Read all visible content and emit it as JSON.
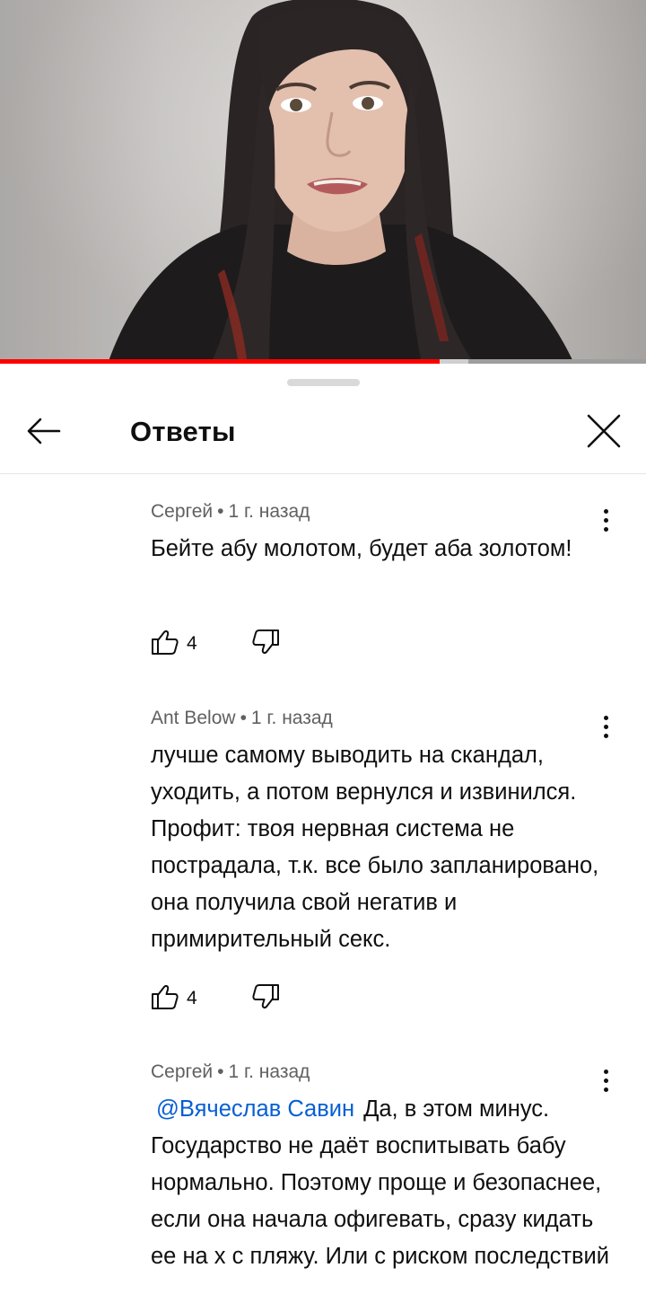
{
  "video": {
    "progress_fraction": 0.68,
    "buffer_fraction": 0.725,
    "progress_color": "#ff0000"
  },
  "sheet": {
    "title": "Ответы",
    "back_icon": "arrow-left-icon",
    "close_icon": "close-icon"
  },
  "comments": [
    {
      "author": "Сергей",
      "separator": "•",
      "time": "1 г. назад",
      "mention": "",
      "text": "Бейте абу молотом, будет аба золотом!",
      "likes": "4"
    },
    {
      "author": "Ant Below",
      "separator": "•",
      "time": "1 г. назад",
      "mention": "",
      "text": "лучше самому выводить на скандал, уходить, а потом вернулся и извинился.  Профит: твоя нервная система не пострадала, т.к. все было запланировано, она получила свой негатив и примирительный секс.",
      "likes": "4"
    },
    {
      "author": "Сергей",
      "separator": "•",
      "time": "1 г. назад",
      "mention": "@Вячеслав Савин",
      "text": "Да, в этом минус. Государство не даёт воспитывать бабу нормально. Поэтому проще и безопаснее, если она начала офигевать, сразу кидать ее на х с пляжу. Или с риском последствий",
      "likes": ""
    }
  ]
}
